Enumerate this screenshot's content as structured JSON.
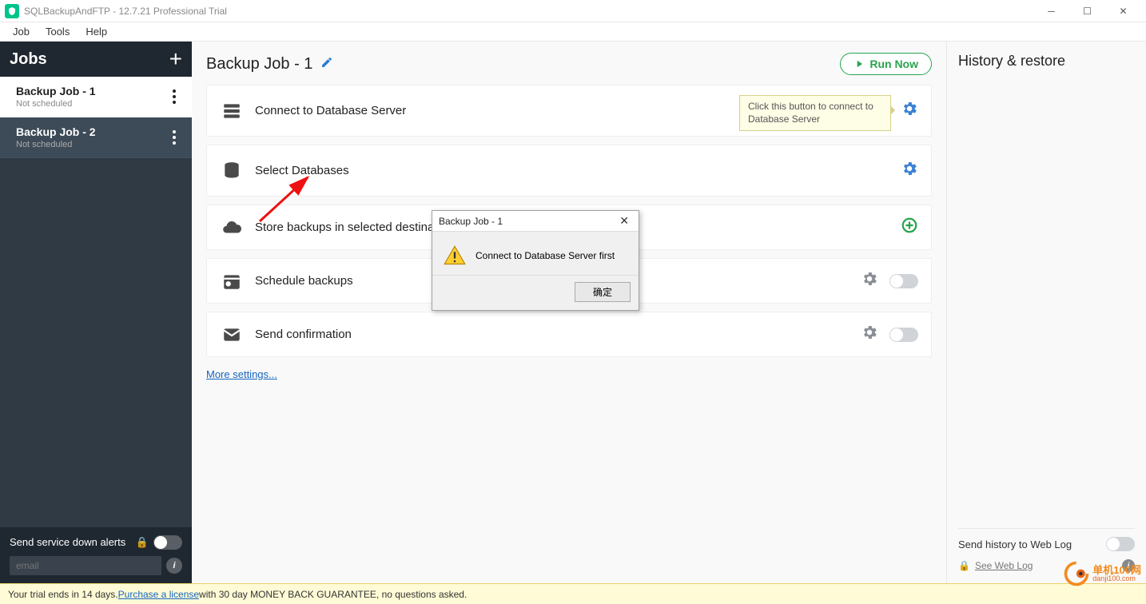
{
  "titlebar": {
    "title": "SQLBackupAndFTP - 12.7.21 Professional Trial"
  },
  "menubar": {
    "items": [
      "Job",
      "Tools",
      "Help"
    ]
  },
  "sidebar": {
    "header": "Jobs",
    "jobs": [
      {
        "title": "Backup Job - 1",
        "sub": "Not scheduled"
      },
      {
        "title": "Backup Job - 2",
        "sub": "Not scheduled"
      }
    ],
    "alerts_label": "Send service down alerts",
    "email_placeholder": "email"
  },
  "center": {
    "title": "Backup Job - 1",
    "run_now": "Run Now",
    "steps": {
      "connect": "Connect to Database Server",
      "select": "Select Databases",
      "store": "Store backups in selected destinations",
      "schedule": "Schedule backups",
      "confirm": "Send confirmation"
    },
    "tooltip": "Click this button to connect to Database Server",
    "more": "More settings..."
  },
  "rightpanel": {
    "title": "History & restore",
    "send_history": "Send history to Web Log",
    "see_weblog": "See Web Log"
  },
  "dialog": {
    "title": "Backup Job - 1",
    "message": "Connect to Database Server first",
    "ok": "确定"
  },
  "footer": {
    "prefix": "Your trial ends in 14 days.  ",
    "link": "Purchase a license",
    "suffix": " with 30 day MONEY BACK GUARANTEE, no questions asked."
  },
  "watermark": {
    "line1": "单机100网",
    "line2": "danji100.com"
  }
}
